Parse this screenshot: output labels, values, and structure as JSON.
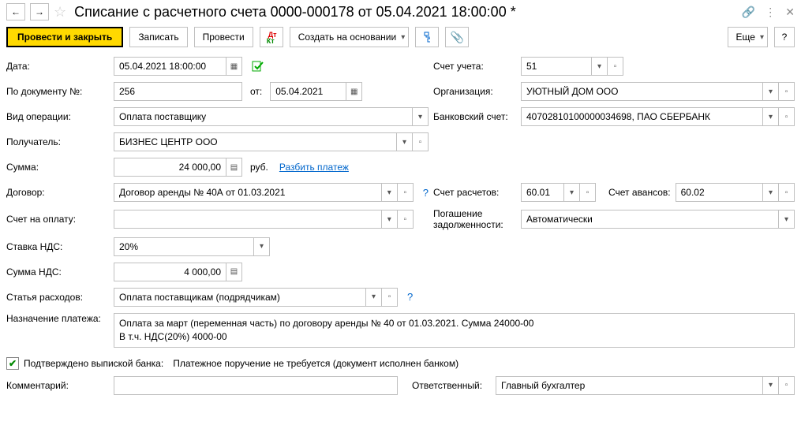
{
  "header": {
    "title": "Списание с расчетного счета 0000-000178 от 05.04.2021 18:00:00 *"
  },
  "toolbar": {
    "submit_close": "Провести и закрыть",
    "write": "Записать",
    "submit": "Провести",
    "create_based": "Создать на основании",
    "more": "Еще"
  },
  "labels": {
    "date": "Дата:",
    "doc_num": "По документу №:",
    "from": "от:",
    "operation_type": "Вид операции:",
    "recipient": "Получатель:",
    "amount": "Сумма:",
    "currency": "руб.",
    "split_payment": "Разбить платеж",
    "contract": "Договор:",
    "invoice": "Счет на оплату:",
    "vat_rate": "Ставка НДС:",
    "vat_amount": "Сумма НДС:",
    "expense_item": "Статья расходов:",
    "payment_purpose": "Назначение платежа:",
    "confirmed_statement": "Подтверждено выпиской банка:",
    "payment_order_note": "Платежное поручение не требуется (документ исполнен банком)",
    "comment": "Комментарий:",
    "account": "Счет учета:",
    "org": "Организация:",
    "bank_account": "Банковский счет:",
    "settlement_account": "Счет расчетов:",
    "advance_account": "Счет авансов:",
    "debt_repayment": "Погашение задолженности:",
    "responsible": "Ответственный:"
  },
  "values": {
    "date": "05.04.2021 18:00:00",
    "doc_num": "256",
    "doc_from": "05.04.2021",
    "operation_type": "Оплата поставщику",
    "recipient": "БИЗНЕС ЦЕНТР ООО",
    "amount": "24 000,00",
    "contract": "Договор аренды № 40А от 01.03.2021",
    "invoice": "",
    "vat_rate": "20%",
    "vat_amount": "4 000,00",
    "expense_item": "Оплата поставщикам (подрядчикам)",
    "payment_purpose_l1": "Оплата за март (переменная часть) по договору аренды № 40 от 01.03.2021. Сумма 24000-00",
    "payment_purpose_l2": "В т.ч. НДС(20%) 4000-00",
    "comment": "",
    "account": "51",
    "org": "УЮТНЫЙ ДОМ ООО",
    "bank_account": "40702810100000034698, ПАО СБЕРБАНК",
    "settlement_account": "60.01",
    "advance_account": "60.02",
    "debt_repayment": "Автоматически",
    "responsible": "Главный бухгалтер"
  }
}
